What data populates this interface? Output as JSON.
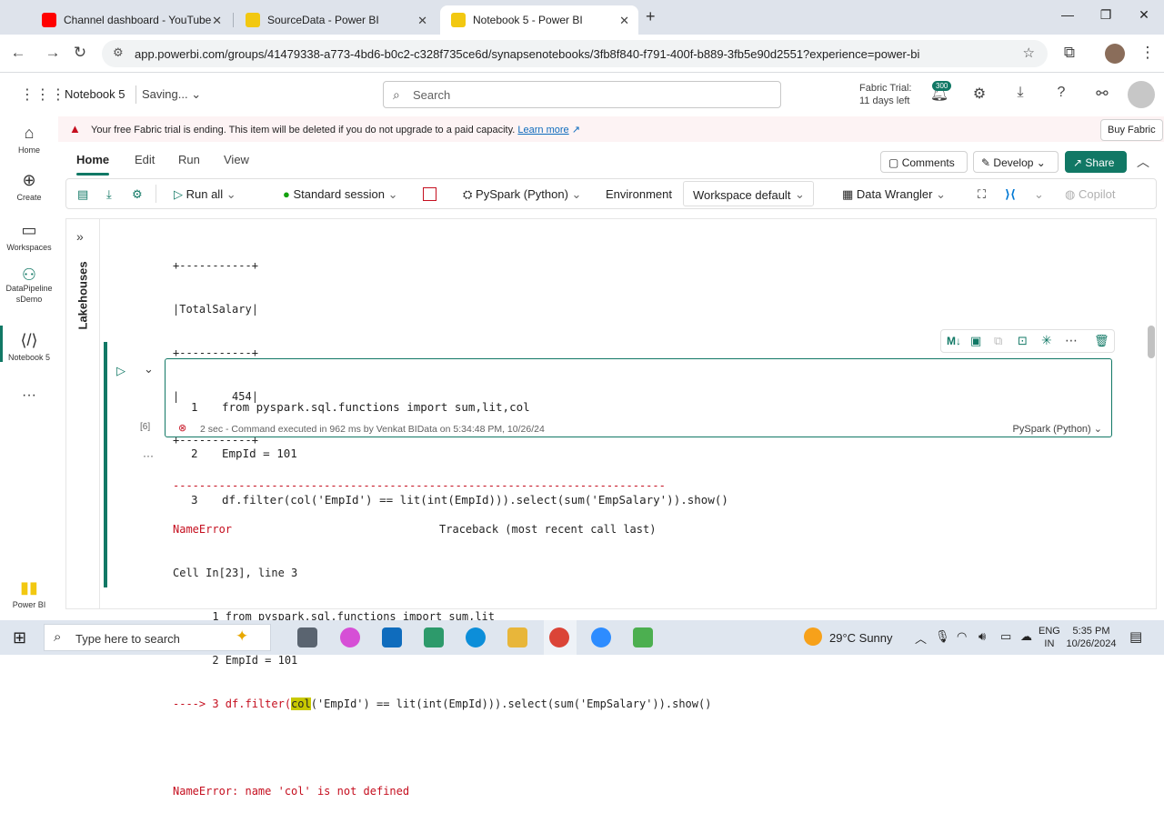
{
  "browser": {
    "tabs": [
      {
        "label": "Channel dashboard - YouTube",
        "active": false
      },
      {
        "label": "SourceData - Power BI",
        "active": false
      },
      {
        "label": "Notebook 5 - Power BI",
        "active": true
      }
    ],
    "url": "app.powerbi.com/groups/41479338-a773-4bd6-b0c2-c328f735ce6d/synapsenotebooks/3fb8f840-f791-400f-b889-3fb5e90d2551?experience=power-bi"
  },
  "header": {
    "title": "Notebook 5",
    "status": "Saving...",
    "search_placeholder": "Search",
    "trial_line1": "Fabric Trial:",
    "trial_line2": "11 days left",
    "notif_count": "300"
  },
  "rail": {
    "items": [
      "Home",
      "Create",
      "Workspaces",
      "DataPipeline sDemo",
      "Notebook 5",
      "Power BI"
    ]
  },
  "banner": {
    "message": "Your free Fabric trial is ending. This item will be deleted if you do not upgrade to a paid capacity.",
    "link": "Learn more",
    "buy": "Buy Fabric"
  },
  "ribbon": {
    "tabs": [
      "Home",
      "Edit",
      "Run",
      "View"
    ],
    "comments": "Comments",
    "develop": "Develop",
    "share": "Share"
  },
  "toolbar": {
    "run_all": "Run all",
    "session": "Standard session",
    "language": "PySpark (Python)",
    "environment": "Environment",
    "workspace": "Workspace default",
    "wrangler": "Data Wrangler",
    "copilot": "Copilot"
  },
  "notebook": {
    "side_label": "Lakehouses",
    "prev_output": [
      "+-----------+",
      "|TotalSalary|",
      "+-----------+",
      "|        454|",
      "+-----------+"
    ],
    "cell_lines": [
      {
        "num": "1",
        "text": "from pyspark.sql.functions import sum,lit,col"
      },
      {
        "num": "2",
        "text": "EmpId = 101"
      },
      {
        "num": "3",
        "text": "df.filter(col('EmpId') == lit(int(EmpId))).select(sum('EmpSalary')).show()"
      }
    ],
    "exec_count": "[6]",
    "exec_status": "2 sec - Command executed in 962 ms by Venkat BIData on 5:34:48 PM, 10/26/24",
    "cell_lang": "PySpark (Python)",
    "error": {
      "dashes": "---------------------------------------------------------------------------",
      "name": "NameError",
      "traceback": "Traceback (most recent call last)",
      "cell": "Cell In[23], line 3",
      "line1": "      1 from pyspark.sql.functions import sum,lit",
      "line2": "      2 EmpId = 101",
      "arrow": "----> 3 df.filter(",
      "highlight": "col",
      "rest": "('EmpId') == lit(int(EmpId))).select(sum('EmpSalary')).show()",
      "message": "NameError: name 'col' is not defined"
    }
  },
  "taskbar": {
    "search": "Type here to search",
    "weather": "29°C  Sunny",
    "lang1": "ENG",
    "lang2": "IN",
    "time": "5:35 PM",
    "date": "10/26/2024"
  }
}
